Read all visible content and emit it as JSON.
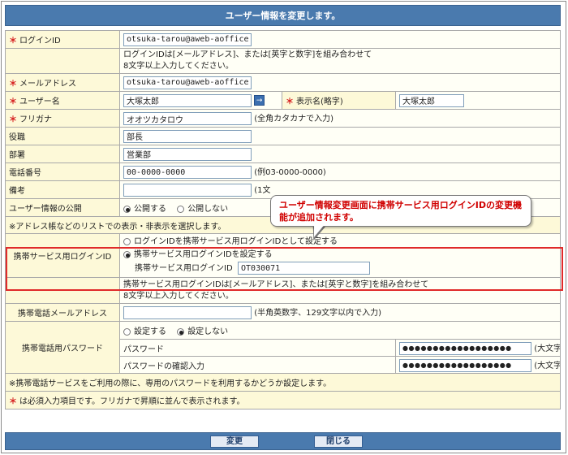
{
  "title": "ユーザー情報を変更します。",
  "required_mark": "＊",
  "fields": {
    "login_id": {
      "label": "ログインID",
      "value": "otsuka-tarou@aweb-aoffice.jp",
      "note1": "ログインIDは[メールアドレス]、または[英字と数字]を組み合わせて",
      "note2": "8文字以上入力してください。"
    },
    "email": {
      "label": "メールアドレス",
      "value": "otsuka-tarou@aweb-aoffice.jp"
    },
    "username": {
      "label": "ユーザー名",
      "value": "大塚太郎",
      "arrow": "→"
    },
    "display_name": {
      "label": "表示名(略字)",
      "value": "大塚太郎"
    },
    "furigana": {
      "label": "フリガナ",
      "value": "オオツカタロウ",
      "hint": "(全角カタカナで入力)"
    },
    "title": {
      "label": "役職",
      "value": "部長"
    },
    "department": {
      "label": "部署",
      "value": "営業部"
    },
    "phone": {
      "label": "電話番号",
      "value": "00-0000-0000",
      "hint": "(例03-0000-0000)"
    },
    "remarks": {
      "label": "備考",
      "value": "",
      "hint": "(1文"
    },
    "publish": {
      "label": "ユーザー情報の公開",
      "opt_on": "公開する",
      "opt_off": "公開しない"
    },
    "publish_note": "※アドレス帳などのリストでの表示・非表示を選択します。",
    "mobile_login": {
      "label": "携帯サービス用ログインID",
      "opt1": "ログインIDを携帯サービス用ログインIDとして設定する",
      "opt2": "携帯サービス用ログインIDを設定する",
      "sub_label": "携帯サービス用ログインID",
      "value": "OT030071",
      "note1": "携帯サービス用ログインIDは[メールアドレス]、または[英字と数字]を組み合わせて",
      "note2": "8文字以上入力してください。"
    },
    "mobile_email": {
      "label": "携帯電話メールアドレス",
      "value": "",
      "hint": "(半角英数字、129文字以内で入力)"
    },
    "mobile_password": {
      "label": "携帯電話用パスワード",
      "opt_set": "設定する",
      "opt_unset": "設定しない",
      "pw_label": "パスワード",
      "pw_confirm_label": "パスワードの確認入力",
      "pw_value": "●●●●●●●●●●●●●●●●●●",
      "pw_confirm_value": "●●●●●●●●●●●●●●●●●●",
      "pw_hint": "(大文字と小文字は区別されません)"
    },
    "mobile_note": "※携帯電話サービスをご利用の際に、専用のパスワードを利用するかどうか設定します。",
    "footer_note": "は必須入力項目です。フリガナで昇順に並んで表示されます。"
  },
  "callout": "ユーザー情報変更画面に携帯サービス用ログインIDの変更機能が追加されます。",
  "buttons": {
    "change": "変更",
    "close": "閉じる"
  }
}
